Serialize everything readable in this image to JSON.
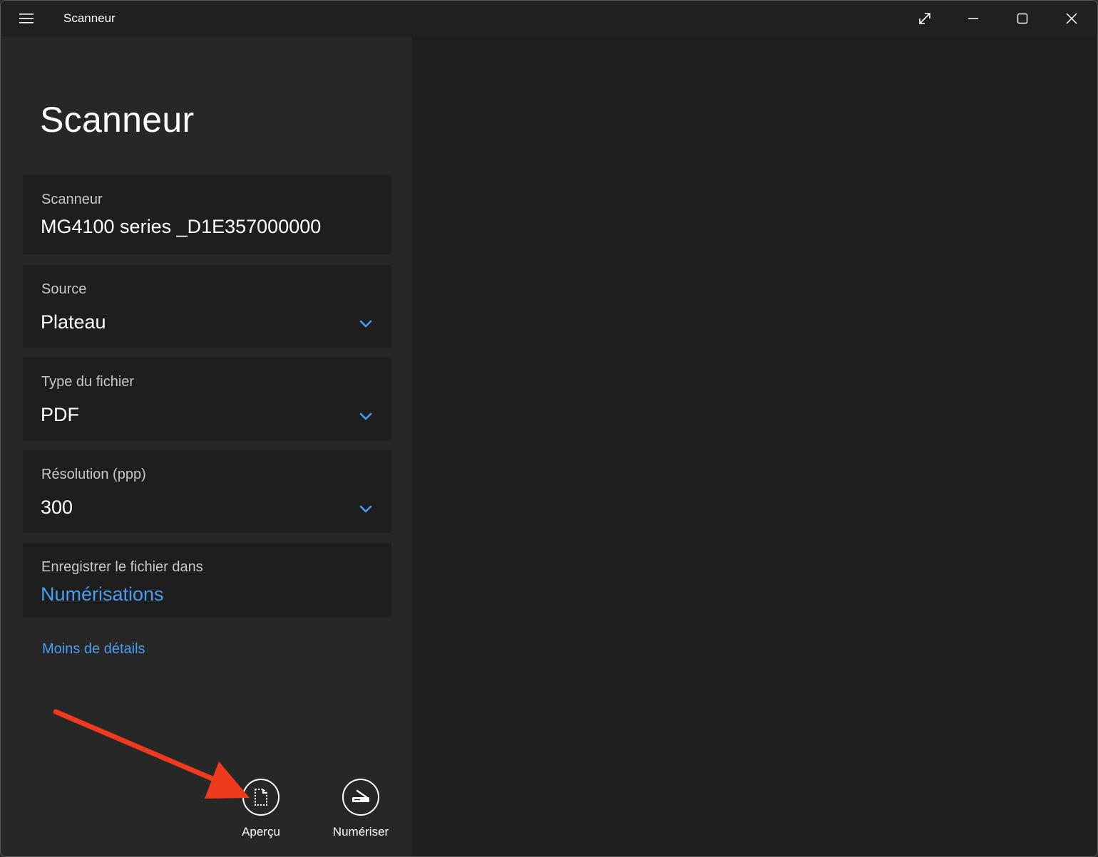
{
  "window": {
    "title": "Scanneur"
  },
  "page": {
    "title": "Scanneur"
  },
  "scanner": {
    "label": "Scanneur",
    "value": "MG4100 series _D1E357000000"
  },
  "source": {
    "label": "Source",
    "value": "Plateau"
  },
  "file_type": {
    "label": "Type du fichier",
    "value": "PDF"
  },
  "resolution": {
    "label": "Résolution (ppp)",
    "value": "300"
  },
  "save_location": {
    "label": "Enregistrer le fichier dans",
    "value": "Numérisations"
  },
  "details_toggle": "Moins de détails",
  "actions": {
    "preview": "Aperçu",
    "scan": "Numériser"
  },
  "colors": {
    "accent": "#4a9cf0",
    "annotation": "#f03a1e"
  },
  "icons": {
    "menu": "hamburger-icon",
    "fullscreen": "expand-icon",
    "minimize": "minimize-icon",
    "maximize": "maximize-icon",
    "close": "close-icon",
    "dropdown": "chevron-down-icon",
    "preview": "preview-page-icon",
    "scan": "scanner-icon"
  }
}
